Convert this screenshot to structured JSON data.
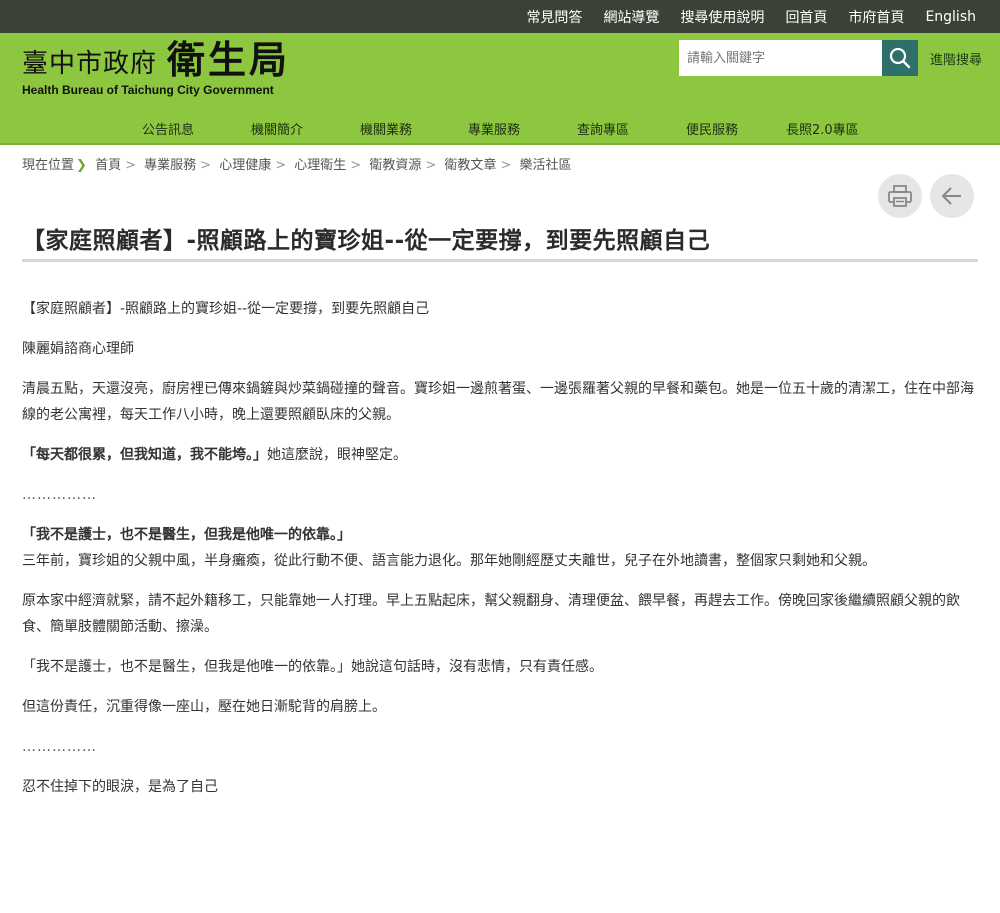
{
  "topbar": {
    "links": [
      "常見問答",
      "網站導覽",
      "搜尋使用說明",
      "回首頁",
      "市府首頁",
      "English"
    ]
  },
  "header": {
    "logo_city": "臺中市政府",
    "logo_bureau": "衛生局",
    "logo_en": "Health Bureau of Taichung City Government",
    "search_placeholder": "請輸入關鍵字",
    "advanced_search": "進階搜尋"
  },
  "nav": {
    "items": [
      "公告訊息",
      "機關簡介",
      "機關業務",
      "專業服務",
      "查詢專區",
      "便民服務",
      "長照2.0專區"
    ]
  },
  "breadcrumb": {
    "label": "現在位置",
    "items": [
      "首頁",
      "專業服務",
      "心理健康",
      "心理衛生",
      "衛教資源",
      "衛教文章",
      "樂活社區"
    ]
  },
  "article": {
    "title": "【家庭照顧者】-照顧路上的寶珍姐--從一定要撐，到要先照顧自己",
    "subtitle": "【家庭照顧者】-照顧路上的寶珍姐--從一定要撐，到要先照顧自己",
    "author": "陳麗娟諮商心理師",
    "p1": "清晨五點，天還沒亮，廚房裡已傳來鍋鏟與炒菜鍋碰撞的聲音。寶珍姐一邊煎著蛋、一邊張羅著父親的早餐和藥包。她是一位五十歲的清潔工，住在中部海線的老公寓裡，每天工作八小時，晚上還要照顧臥床的父親。",
    "quote1": "「每天都很累，但我知道，我不能垮。」",
    "quote1_tail": "她這麼說，眼神堅定。",
    "dots1": "……………",
    "heading2": "「我不是護士，也不是醫生，但我是他唯一的依靠。」",
    "p2": "三年前，寶珍姐的父親中風，半身癱瘓，從此行動不便、語言能力退化。那年她剛經歷丈夫離世，兒子在外地讀書，整個家只剩她和父親。",
    "p3": "原本家中經濟就緊，請不起外籍移工，只能靠她一人打理。早上五點起床，幫父親翻身、清理便盆、餵早餐，再趕去工作。傍晚回家後繼續照顧父親的飲食、簡單肢體關節活動、擦澡。",
    "p4": "「我不是護士，也不是醫生，但我是他唯一的依靠。」她說這句話時，沒有悲情，只有責任感。",
    "p5": "但這份責任，沉重得像一座山，壓在她日漸駝背的肩膀上。",
    "dots2": "……………",
    "p6": "忍不住掉下的眼淚，是為了自己"
  },
  "colors": {
    "topbar": "#3c4138",
    "header": "#8dc63f",
    "search_button": "#2e6e6b",
    "breadcrumb_arrow": "#6fa632"
  },
  "icons": [
    "search-icon",
    "print-icon",
    "back-arrow-icon",
    "chevron-right-icon"
  ]
}
